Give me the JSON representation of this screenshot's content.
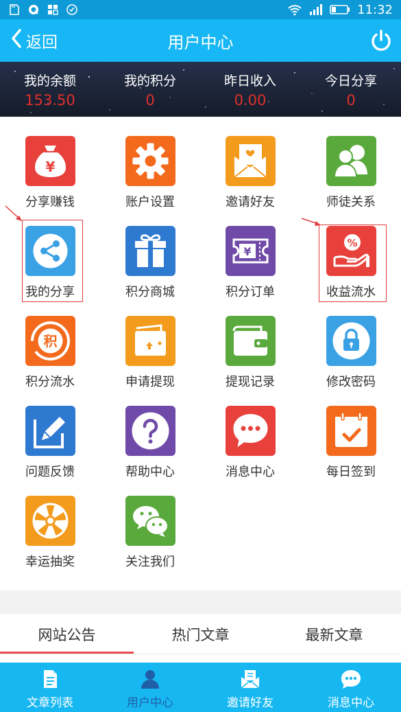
{
  "status_bar": {
    "time": "11:32"
  },
  "header": {
    "back_label": "返回",
    "title": "用户中心"
  },
  "stats": [
    {
      "label": "我的余额",
      "value": "153.50"
    },
    {
      "label": "我的积分",
      "value": "0"
    },
    {
      "label": "昨日收入",
      "value": "0.00"
    },
    {
      "label": "今日分享",
      "value": "0"
    }
  ],
  "grid": [
    {
      "label": "分享赚钱",
      "icon": "money-bag-icon",
      "color": "#e8413c"
    },
    {
      "label": "账户设置",
      "icon": "gear-icon",
      "color": "#f36a1c"
    },
    {
      "label": "邀请好友",
      "icon": "invite-envelope-icon",
      "color": "#f39b1c"
    },
    {
      "label": "师徒关系",
      "icon": "users-icon",
      "color": "#5aa93d"
    },
    {
      "label": "我的分享",
      "icon": "share-icon",
      "color": "#3aa1e5"
    },
    {
      "label": "积分商城",
      "icon": "gift-icon",
      "color": "#2f7ad1"
    },
    {
      "label": "积分订单",
      "icon": "ticket-icon",
      "color": "#6f4aa8"
    },
    {
      "label": "收益流水",
      "icon": "percent-hand-icon",
      "color": "#e8413c"
    },
    {
      "label": "积分流水",
      "icon": "points-icon",
      "color": "#f36a1c"
    },
    {
      "label": "申请提现",
      "icon": "withdraw-card-icon",
      "color": "#f39b1c"
    },
    {
      "label": "提现记录",
      "icon": "wallet-icon",
      "color": "#5aa93d"
    },
    {
      "label": "修改密码",
      "icon": "lock-icon",
      "color": "#3aa1e5"
    },
    {
      "label": "问题反馈",
      "icon": "pencil-icon",
      "color": "#2f7ad1"
    },
    {
      "label": "帮助中心",
      "icon": "help-icon",
      "color": "#6f4aa8"
    },
    {
      "label": "消息中心",
      "icon": "chat-bubble-icon",
      "color": "#e8413c"
    },
    {
      "label": "每日签到",
      "icon": "calendar-check-icon",
      "color": "#f36a1c"
    },
    {
      "label": "幸运抽奖",
      "icon": "wheel-icon",
      "color": "#f39b1c"
    },
    {
      "label": "关注我们",
      "icon": "wechat-icon",
      "color": "#5aa93d"
    }
  ],
  "tabs": [
    {
      "label": "网站公告"
    },
    {
      "label": "热门文章"
    },
    {
      "label": "最新文章"
    }
  ],
  "bottom_nav": [
    {
      "label": "文章列表",
      "icon": "document-icon"
    },
    {
      "label": "用户中心",
      "icon": "user-icon"
    },
    {
      "label": "邀请好友",
      "icon": "invite-icon"
    },
    {
      "label": "消息中心",
      "icon": "message-icon"
    }
  ],
  "colors": {
    "header": "#16b7f4",
    "status_bar": "#0e9ad6",
    "stat_value": "#e0302c",
    "active_nav": "#1f5fa8",
    "tab_underline": "#e84c4c",
    "annotation": "#e23b3b"
  }
}
